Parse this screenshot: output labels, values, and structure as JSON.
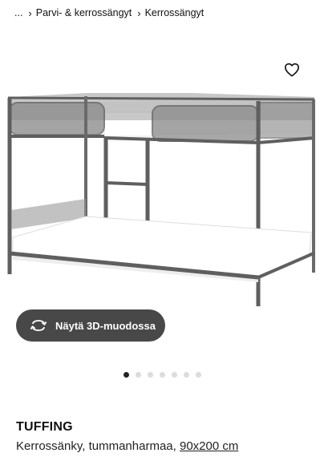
{
  "breadcrumb": {
    "ellipsis": "...",
    "items": [
      "Parvi- & kerrossängyt",
      "Kerrossängyt"
    ]
  },
  "favorite": {
    "icon": "heart-outline-icon"
  },
  "view3d": {
    "label": "Näytä 3D-muodossa",
    "icon": "rotate-3d-icon"
  },
  "gallery": {
    "count": 7,
    "active_index": 0
  },
  "product": {
    "name": "TUFFING",
    "description": "Kerrossänky, tummanharmaa,",
    "size": "90x200 cm"
  },
  "colors": {
    "frame": "#6a6a6a",
    "button_bg": "#484848",
    "dot_active": "#222222",
    "dot_inactive": "#dcdcdc"
  }
}
